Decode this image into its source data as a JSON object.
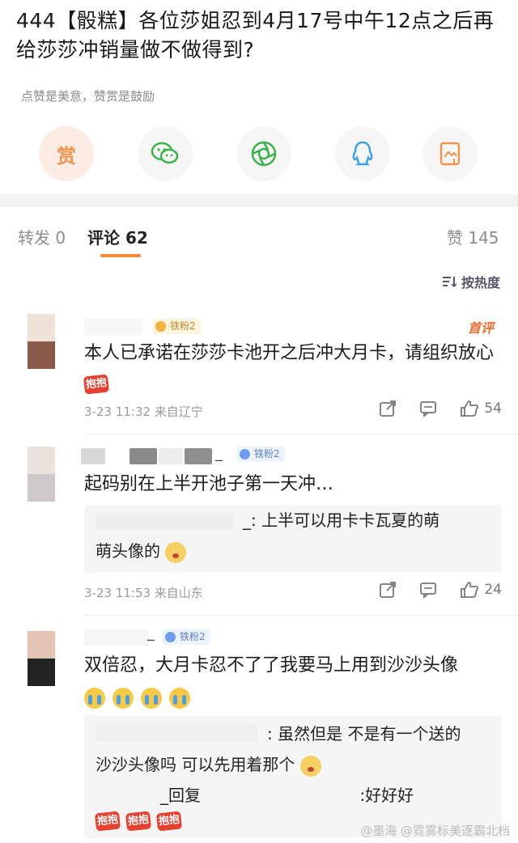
{
  "post": {
    "title": "444【骰糕】各位莎姐忍到4月17号中午12点之后再给莎莎冲销量做不做得到?",
    "tip": "点赞是美意，赞赏是鼓励"
  },
  "share": {
    "reward_label": "赏",
    "icons": [
      "wechat-icon",
      "moments-icon",
      "qq-icon",
      "save-image-icon"
    ]
  },
  "tabs": {
    "repost": "转发 0",
    "comment": "评论 62",
    "like": "赞 145"
  },
  "sort": {
    "label": "按热度"
  },
  "colors": {
    "accent": "#f68a3a",
    "reward": "#f4934b",
    "badge": "#6f9cf0"
  },
  "comments": [
    {
      "badge": "铁粉2",
      "first_tag": "首评",
      "text": "本人已承诺在莎莎卡池开之后冲大月卡，请组织放心",
      "hug": "抱抱",
      "time": "3-23 11:32 来自辽宁",
      "likes": "54"
    },
    {
      "name_suffix": "_",
      "badge": "铁粉2",
      "text": "起码别在上半开池子第一天冲…",
      "reply": {
        "line1": "_: 上半可以用卡卡瓦夏的萌",
        "line2": "萌头像的"
      },
      "time": "3-23 11:53 来自山东",
      "likes": "24"
    },
    {
      "name_suffix": "_",
      "badge": "铁粉2",
      "text": "双倍忍，大月卡忍不了了我要马上用到沙沙头像",
      "reply": {
        "line1": ": 虽然但是 不是有一个送的",
        "line2": "沙沙头像吗 可以先用着那个",
        "line3a": "_回复",
        "line3b": ":好好好"
      }
    }
  ],
  "watermark": "@墨海 @霓雾标美逐霸北档"
}
